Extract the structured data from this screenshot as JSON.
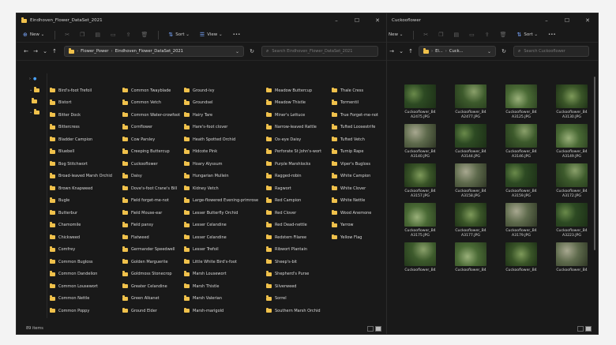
{
  "window1": {
    "title": "Eindhoven_Flower_DataSet_2021",
    "controls": {
      "minimize": "–",
      "maximize": "☐",
      "close": "✕"
    },
    "toolbar": {
      "new": "New",
      "sort": "Sort",
      "view": "View",
      "more": "•••"
    },
    "nav": {
      "back": "←",
      "forward": "→",
      "down": "⌄",
      "up": "↑",
      "refresh": "↻"
    },
    "address": {
      "crumbs": [
        "Flower_Power",
        "Eindhoven_Flower_DataSet_2021"
      ],
      "dropdown": "⌄"
    },
    "search_placeholder": "Search Eindhoven_Flower_DataSet_2021",
    "items": [
      "Bird's-foot Trefoil",
      "Bistort",
      "Bitter Dock",
      "Bittercress",
      "Bladder Campion",
      "Bluebell",
      "Bog Stitchwort",
      "Broad-leaved Marsh Orchid",
      "Brown Knapweed",
      "Bugle",
      "Butterbur",
      "Chamomile",
      "Chickweed",
      "Comfrey",
      "Common Bugloss",
      "Common Dandelion",
      "Common Lousewort",
      "Common Nettle",
      "Common Poppy",
      "Common Twayblade",
      "Common Vetch",
      "Common Water-crowfoot",
      "Cornflower",
      "Cow Parsley",
      "Creeping Buttercup",
      "Cuckooflower",
      "Daisy",
      "Dove's-foot Crane's Bill",
      "Field forget-me-not",
      "Field Mouse-ear",
      "Field pansy",
      "Flatweed",
      "Germander Speedwell",
      "Golden Marguerite",
      "Goldmoss Stonecrop",
      "Greater Celandine",
      "Green Alkanet",
      "Ground Elder",
      "Ground-ivy",
      "Groundsel",
      "Hairy Tare",
      "Hare's-foot clover",
      "Heath Spotted Orchid",
      "Hidcote Pink",
      "Hoary Alyssum",
      "Hungarian Mullein",
      "Kidney Vetch",
      "Large-flowered Evening-primrose",
      "Lesser Butterfly Orchid",
      "Lesser Celandine",
      "Lesser Celandine",
      "Lesser Trefoil",
      "Little White Bird's-foot",
      "Marsh Lousewort",
      "Marsh Thistle",
      "Marsh Valerian",
      "Marsh-marigold",
      "Meadow Buttercup",
      "Meadow Thistle",
      "Miner's Lettuce",
      "Narrow-leaved Rattle",
      "Ox-eye Daisy",
      "Perforate St John's-wort",
      "Purple Marshlocks",
      "Ragged-robin",
      "Ragwort",
      "Red Campion",
      "Red Clover",
      "Red Dead-nettle",
      "Redstem Filaree",
      "Ribwort Plantain",
      "Sheep's-bit",
      "Shepherd's Purse",
      "Silverweed",
      "Sorrel",
      "Southern Marsh Orchid",
      "Thale Cress",
      "Tormentil",
      "True Forget-me-not",
      "Tufted Loosestrife",
      "Tufted Vetch",
      "Turnip Rape",
      "Viper's Bugloss",
      "White Campion",
      "White Clover",
      "White Nettle",
      "Wood Anemone",
      "Yarrow",
      "Yellow Flag"
    ],
    "status": "89 items"
  },
  "window2": {
    "title": "Cuckooflower",
    "controls": {
      "minimize": "–",
      "maximize": "☐",
      "close": "✕"
    },
    "toolbar": {
      "new": "New",
      "sort": "Sort",
      "more": "•••"
    },
    "address": {
      "crumbs": [
        "El...",
        "Cuck..."
      ],
      "dropdown": "⌄"
    },
    "search_placeholder": "Search Cuckooflower",
    "files": [
      "Cuckooflower_B4 A2475.JPG",
      "Cuckooflower_B4 A2477.JPG",
      "Cuckooflower_B4 A3125.JPG",
      "Cuckooflower_B4 A3130.JPG",
      "Cuckooflower_B4 A3140.JPG",
      "Cuckooflower_B4 A3144.JPG",
      "Cuckooflower_B4 A3146.JPG",
      "Cuckooflower_B4 A3149.JPG",
      "Cuckooflower_B4 A3157.JPG",
      "Cuckooflower_B4 A3158.JPG",
      "Cuckooflower_B4 A3159.JPG",
      "Cuckooflower_B4 A3172.JPG",
      "Cuckooflower_B4 A3175.JPG",
      "Cuckooflower_B4 A3177.JPG",
      "Cuckooflower_B4 A3179.JPG",
      "Cuckooflower_B4 A3223.JPG",
      "Cuckooflower_B4",
      "Cuckooflower_B4",
      "Cuckooflower_B4",
      "Cuckooflower_B4"
    ]
  },
  "colors": {
    "folder": "#f0c14b",
    "background": "#191919",
    "accent": "#7aa8ff"
  }
}
